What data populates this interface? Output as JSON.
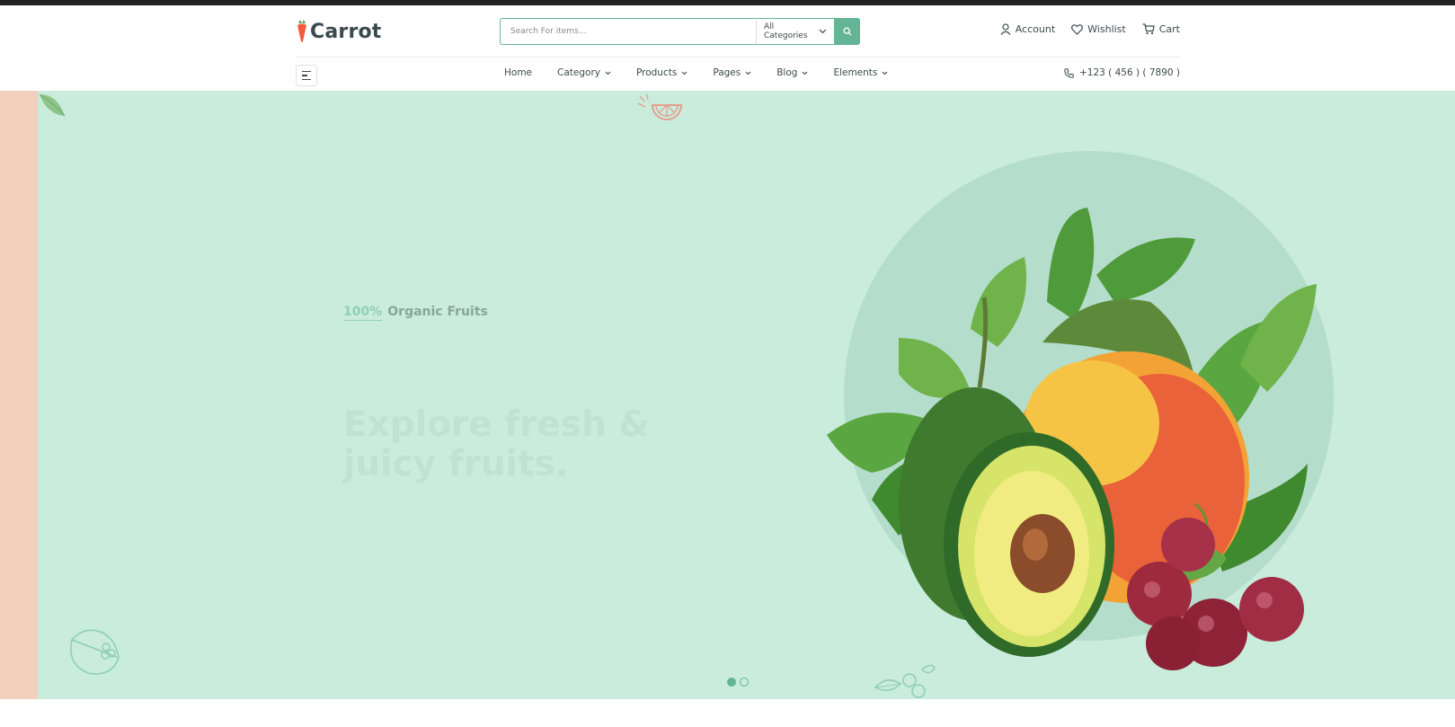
{
  "brand": {
    "name": "Carrot"
  },
  "search": {
    "placeholder": "Search For items...",
    "category": "All Categories"
  },
  "header_actions": [
    {
      "label": "Account",
      "icon": "user-icon"
    },
    {
      "label": "Wishlist",
      "icon": "heart-icon"
    },
    {
      "label": "Cart",
      "icon": "cart-icon"
    }
  ],
  "nav": {
    "items": [
      {
        "label": "Home",
        "dropdown": false
      },
      {
        "label": "Category",
        "dropdown": true
      },
      {
        "label": "Products",
        "dropdown": true
      },
      {
        "label": "Pages",
        "dropdown": true
      },
      {
        "label": "Blog",
        "dropdown": true
      },
      {
        "label": "Elements",
        "dropdown": true
      }
    ],
    "phone": "+123 ( 456 ) ( 7890 )"
  },
  "hero": {
    "tag_percent": "100%",
    "tag_text": "Organic Fruits",
    "title": "Explore fresh &\njuicy fruits.",
    "slide_count": 2,
    "active_slide": 1
  },
  "colors": {
    "accent": "#64b496",
    "hero_bg": "#c9ecdc",
    "peach": "#f2d0bd",
    "text": "#3b4a4d",
    "carrot": "#f15b3a"
  }
}
